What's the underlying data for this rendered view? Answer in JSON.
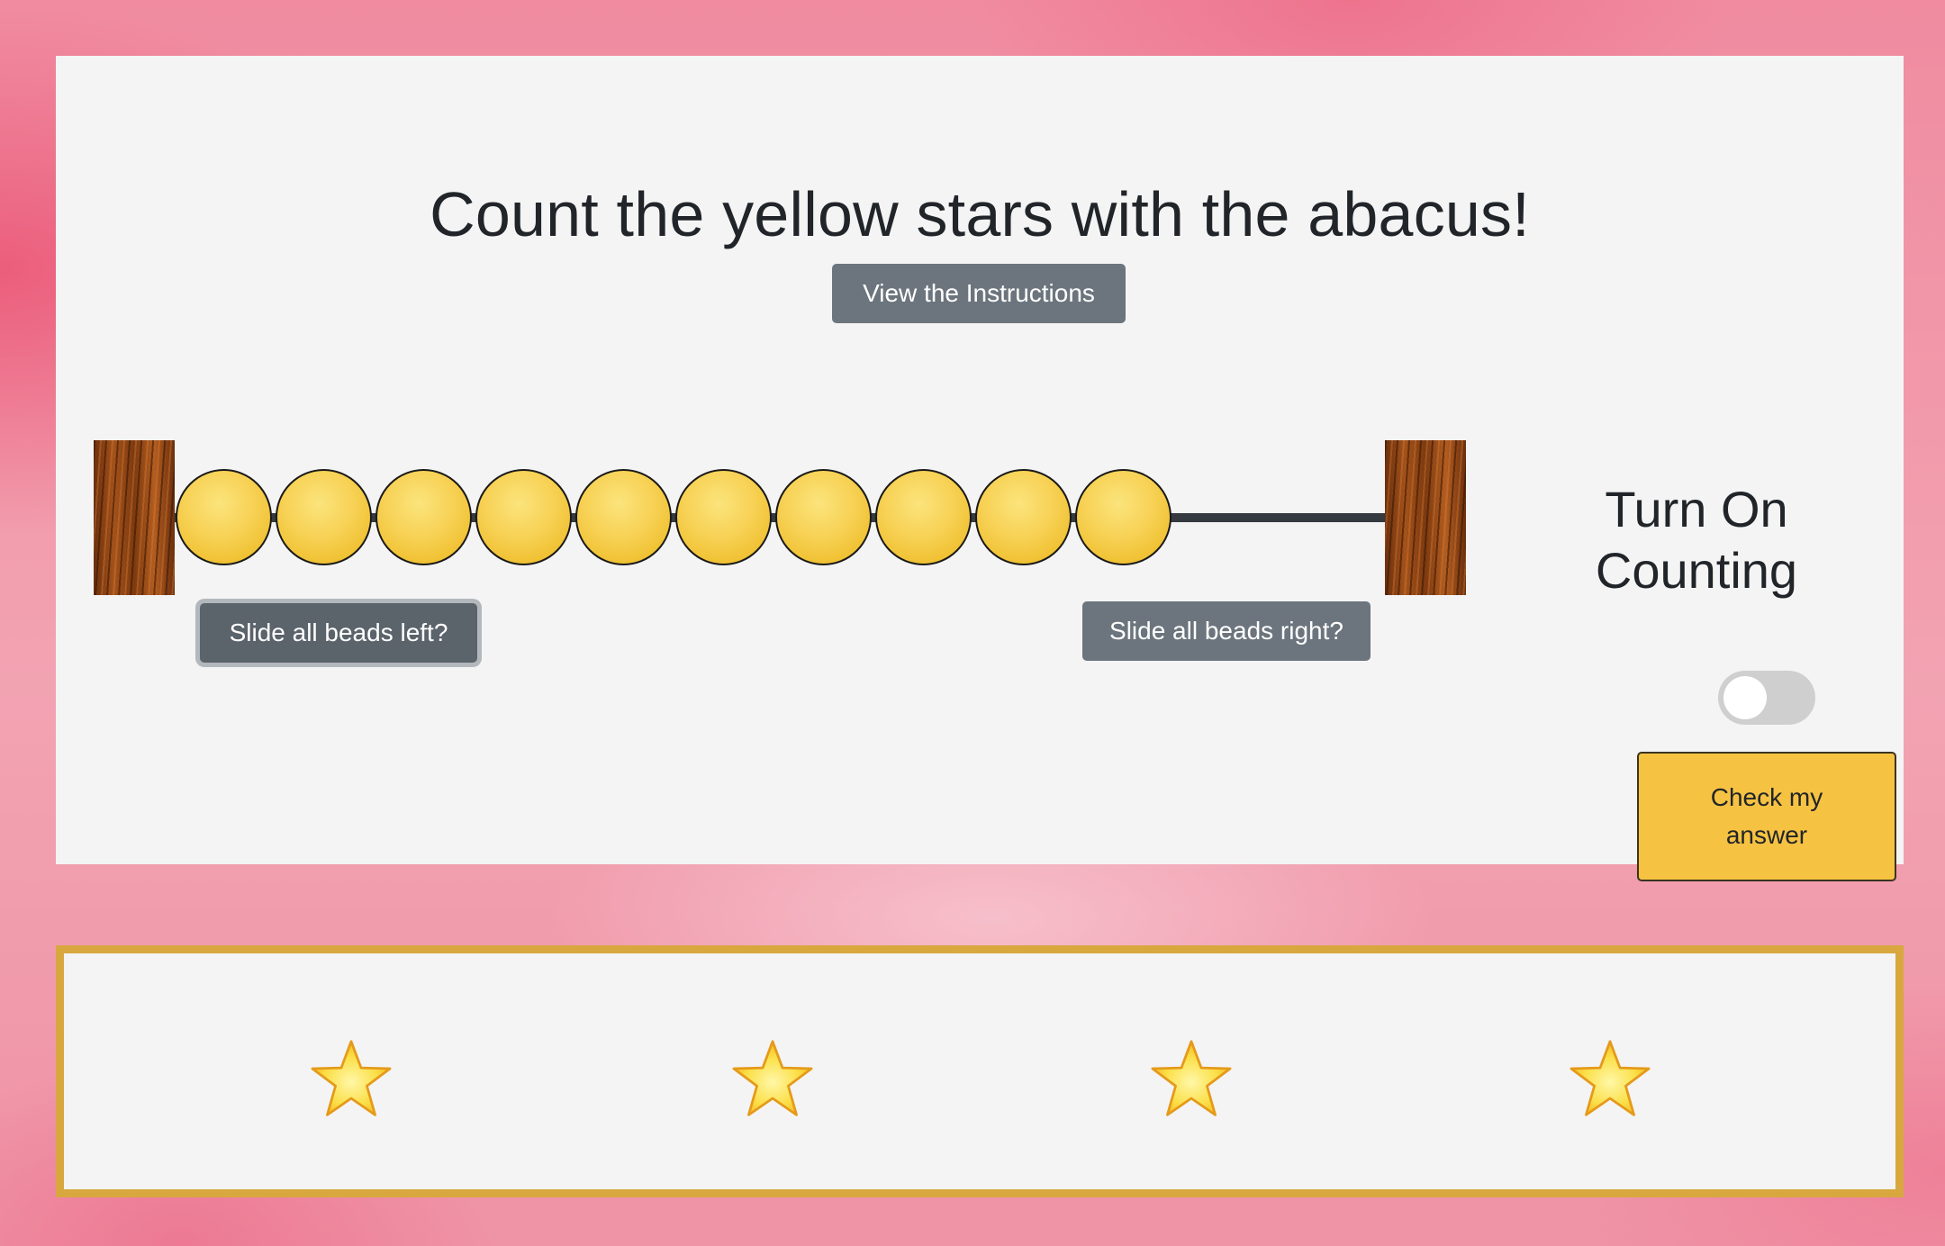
{
  "header": {
    "title": "Count the yellow stars with the abacus!",
    "instructions_button": "View the Instructions"
  },
  "abacus": {
    "bead_count": 10,
    "bead_color": "#f7d154",
    "slide_left_button": "Slide all beads left?",
    "slide_right_button": "Slide all beads right?"
  },
  "counting": {
    "label": "Turn On Counting",
    "toggle_on": false
  },
  "check_button": "Check my answer",
  "stars": {
    "count": 4,
    "color": "#fbe04a",
    "icon": "star-icon"
  },
  "colors": {
    "panel_background": "#f4f4f4",
    "button_secondary": "#6c757d",
    "check_button": "#f6c242",
    "stars_border": "#d8a83f"
  }
}
